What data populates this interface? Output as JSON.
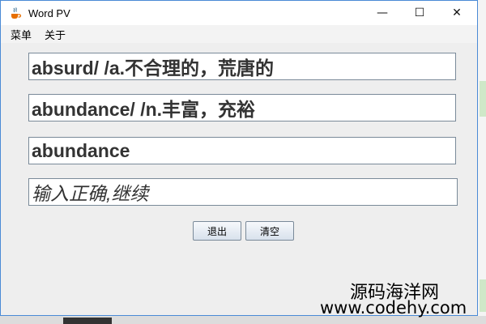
{
  "window": {
    "title": "Word PV",
    "minimize_glyph": "—",
    "maximize_glyph": "☐",
    "close_glyph": "✕",
    "border_color": "#4a8ad6"
  },
  "menu": {
    "items": [
      "菜单",
      "关于"
    ]
  },
  "fields": {
    "line1": "absurd/ /a.不合理的，荒唐的",
    "line2": "abundance/ /n.丰富，充裕",
    "input": "abundance",
    "status": "输入正确,继续"
  },
  "buttons": {
    "exit": "退出",
    "clear": "清空"
  },
  "watermark": {
    "line1": "源码海洋网",
    "line2": "www.codehy.com"
  },
  "icons": {
    "app": "java-cup-icon"
  }
}
